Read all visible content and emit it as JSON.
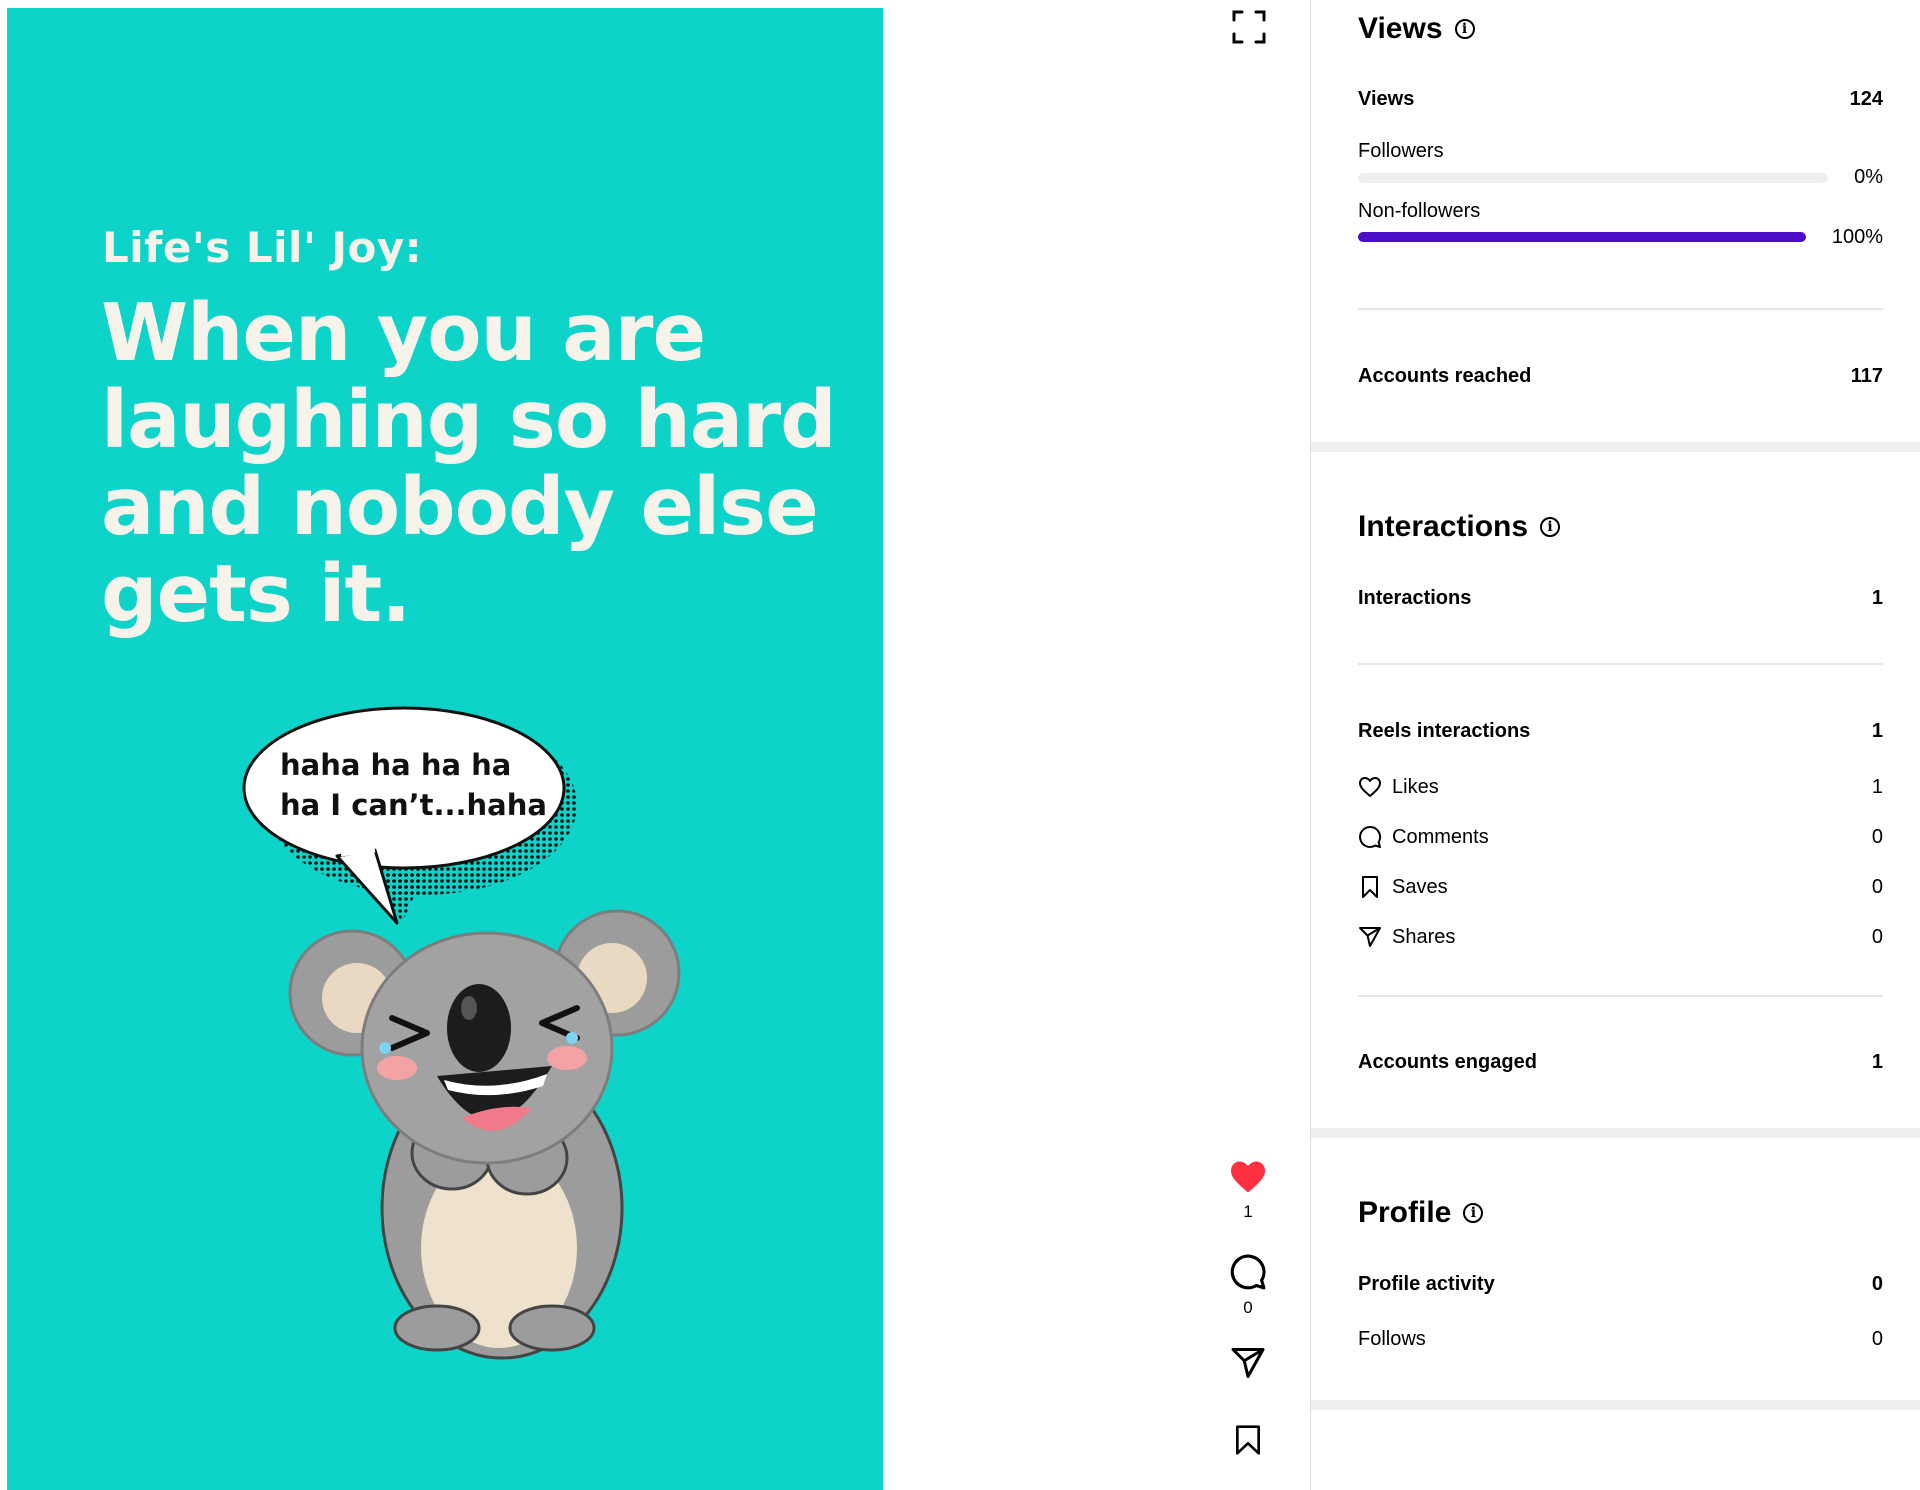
{
  "reel": {
    "kicker": "Life's Lil' Joy:",
    "headline": "When you are laughing so hard and nobody else gets it.",
    "bubble_line1": "haha ha ha ha",
    "bubble_line2": "ha I can’t...haha",
    "background": "#0dd3c8"
  },
  "actions": {
    "fullscreen_icon": "fullscreen-icon",
    "likes_count": "1",
    "comments_count": "0",
    "like_color": "#ff3040"
  },
  "views": {
    "title": "Views",
    "views_label": "Views",
    "views_value": "124",
    "followers_label": "Followers",
    "followers_pct": "0%",
    "followers_fraction": 0,
    "nonfollowers_label": "Non-followers",
    "nonfollowers_pct": "100%",
    "nonfollowers_fraction": 1,
    "bar_color": "#4a0fc7",
    "reached_label": "Accounts reached",
    "reached_value": "117"
  },
  "interactions": {
    "title": "Interactions",
    "interactions_label": "Interactions",
    "interactions_value": "1",
    "reels_label": "Reels interactions",
    "reels_value": "1",
    "likes_label": "Likes",
    "likes_value": "1",
    "comments_label": "Comments",
    "comments_value": "0",
    "saves_label": "Saves",
    "saves_value": "0",
    "shares_label": "Shares",
    "shares_value": "0",
    "engaged_label": "Accounts engaged",
    "engaged_value": "1"
  },
  "profile": {
    "title": "Profile",
    "activity_label": "Profile activity",
    "activity_value": "0",
    "follows_label": "Follows",
    "follows_value": "0"
  }
}
